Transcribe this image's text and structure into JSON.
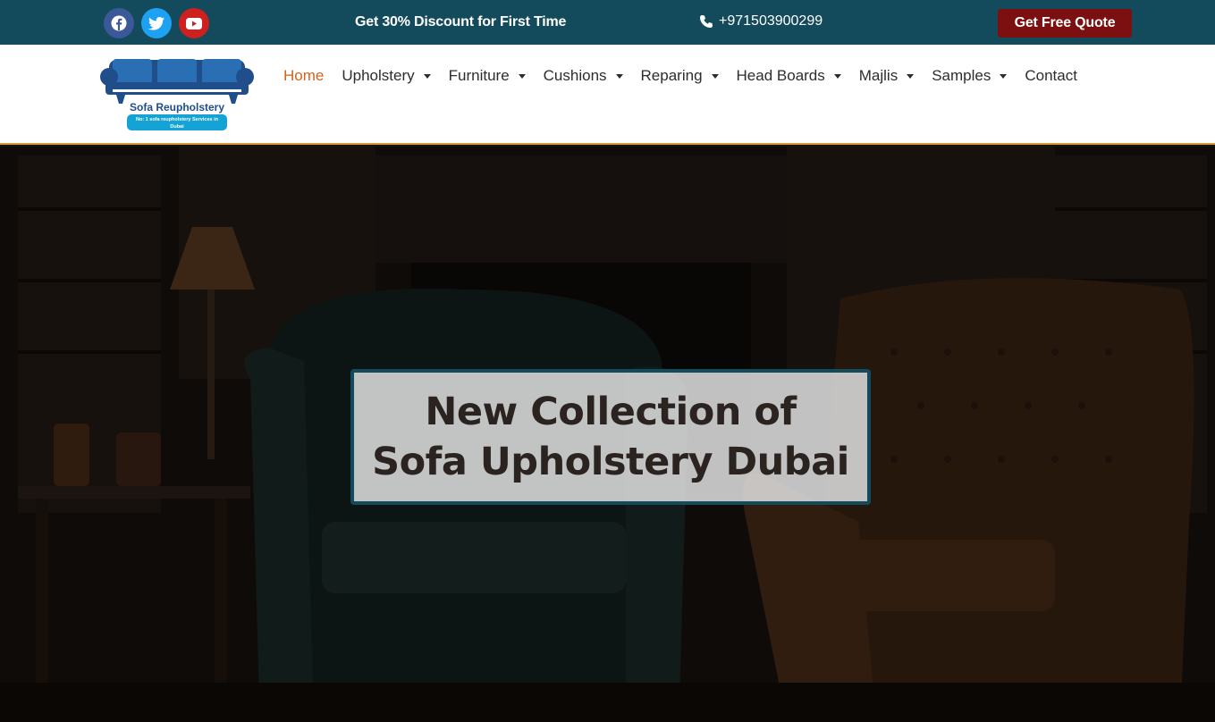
{
  "topbar": {
    "social": [
      {
        "icon": "facebook-icon",
        "color": "#3b5998"
      },
      {
        "icon": "twitter-icon",
        "color": "#1da1f2"
      },
      {
        "icon": "youtube-icon",
        "color": "#cd201f"
      }
    ],
    "discount_text": "Get 30% Discount for First Time",
    "phone_icon": "phone-icon",
    "phone": "+971503900299",
    "quote_button": "Get Free Quote",
    "background": "#134b5c",
    "quote_color": "#7c0f0f"
  },
  "logo": {
    "brand": "Sofa Reupholstery",
    "tagline_1": "No: 1 sofa reupholstery Services in",
    "tagline_2": "Dubai"
  },
  "nav": {
    "items": [
      {
        "label": "Home",
        "active": true,
        "dropdown": false
      },
      {
        "label": "Upholstery",
        "dropdown": true
      },
      {
        "label": "Furniture",
        "dropdown": true
      },
      {
        "label": "Cushions",
        "dropdown": true
      },
      {
        "label": "Reparing",
        "dropdown": true
      },
      {
        "label": "Head Boards",
        "dropdown": true
      },
      {
        "label": "Majlis",
        "dropdown": true
      },
      {
        "label": "Samples",
        "dropdown": true
      },
      {
        "label": "Contact",
        "dropdown": false
      }
    ],
    "active_color": "#d2631c",
    "border_color": "#d99a3b"
  },
  "hero": {
    "line1": "New Collection of",
    "line2": "Sofa Upholstery Dubai"
  }
}
